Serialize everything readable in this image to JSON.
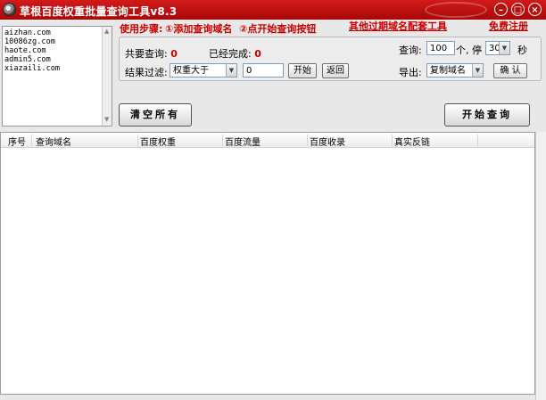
{
  "window": {
    "title": "草根百度权重批量查询工具v8.3",
    "controls": {
      "minimize": "–",
      "maximize": "□",
      "close": "×"
    }
  },
  "domains": {
    "lines": [
      "aizhan.com",
      "10086zg.com",
      "haote.com",
      "admin5.com",
      "xiazaili.com"
    ]
  },
  "instructions": {
    "label": "使用步骤:",
    "step1": "①添加查询域名",
    "step2": "②点开始查询按钮"
  },
  "links": {
    "other_tools": "其他过期域名配套工具",
    "register": "免费注册"
  },
  "panel": {
    "total_label": "共要查询:",
    "total_value": "0",
    "done_label": "已经完成:",
    "done_value": "0",
    "filter_label": "结果过滤:",
    "filter_select": "权重大于",
    "filter_value": "0",
    "filter_start": "开始",
    "filter_back": "返回",
    "query_label": "查询:",
    "query_count": "100",
    "query_unit": "个, 停",
    "pause_value": "30",
    "pause_unit": "秒",
    "export_label": "导出:",
    "export_select": "复制域名",
    "confirm": "确 认"
  },
  "actions": {
    "clear_all": "清空所有",
    "start_query": "开始查询"
  },
  "table": {
    "columns": [
      "序号",
      "查询域名",
      "百度权重",
      "百度流量",
      "百度收录",
      "真实反链"
    ],
    "rows": []
  }
}
